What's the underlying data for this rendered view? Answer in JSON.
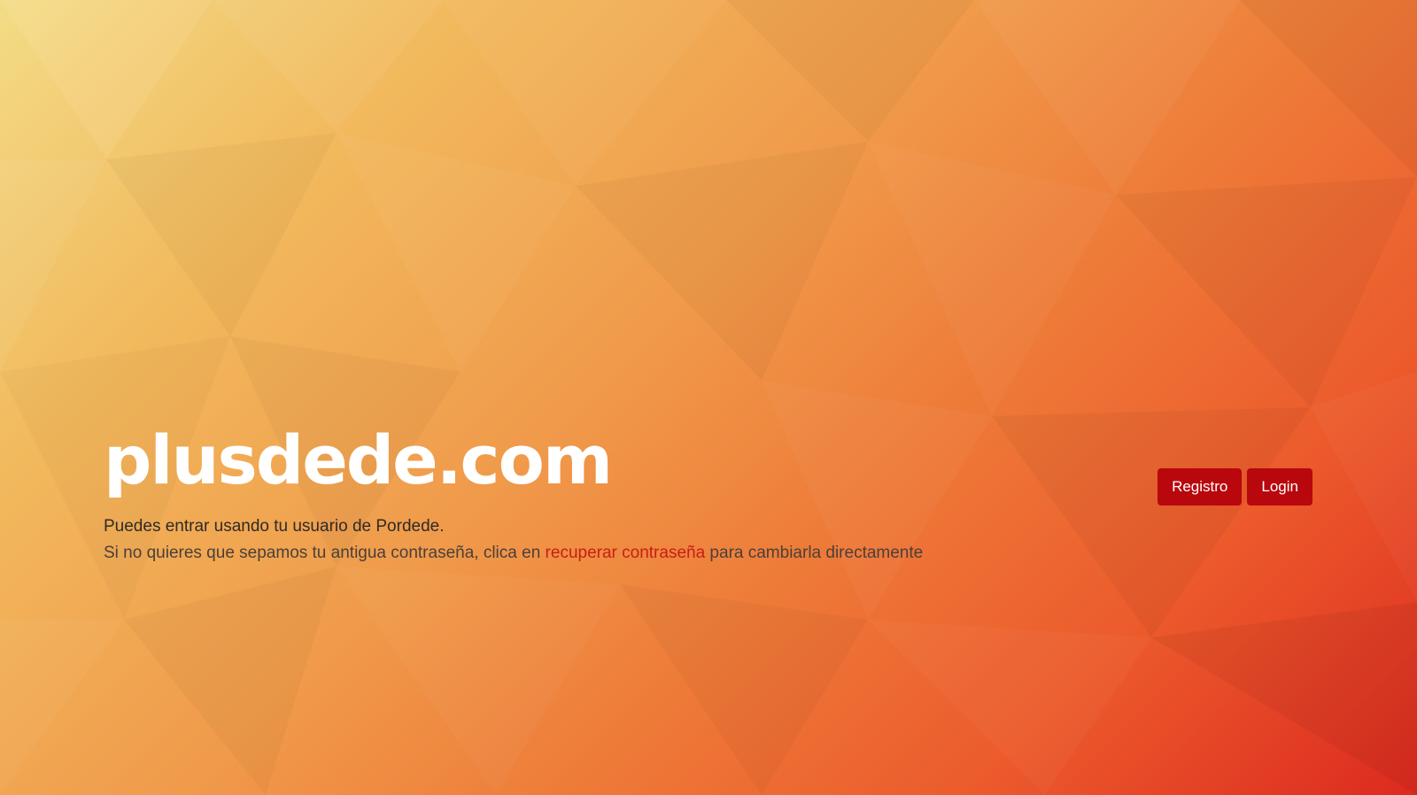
{
  "brand": {
    "title": "plusdede.com"
  },
  "intro": {
    "line1": "Puedes entrar usando tu usuario de Pordede.",
    "line2_before": "Si no quieres que sepamos tu antigua contraseña, clica en ",
    "line2_link": "recuperar contraseña",
    "line2_after": " para cambiarla directamente"
  },
  "actions": {
    "register_label": "Registro",
    "login_label": "Login"
  },
  "colors": {
    "button_bg": "#b8070d",
    "link": "#c81e14",
    "gradient_start": "#f3dc86",
    "gradient_end": "#dc2a1f"
  }
}
